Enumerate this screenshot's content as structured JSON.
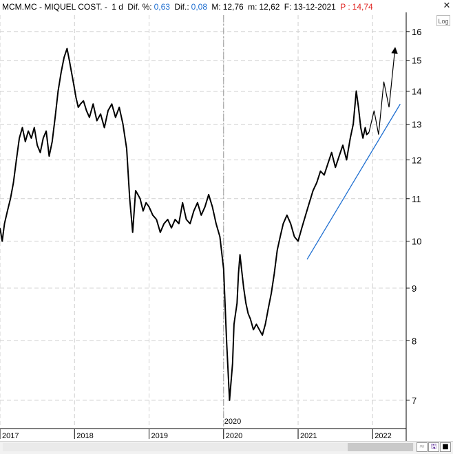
{
  "header": {
    "symbol": "MCM.MC - MIQUEL COST. -",
    "period": "1 d",
    "dif_pct_label": "Dif. %:",
    "dif_pct_value": "0,63",
    "dif_label": "Dif.:",
    "dif_value": "0,08",
    "max_label": "M:",
    "max_value": "12,76",
    "min_label": "m:",
    "min_value": "12,62",
    "date_label": "F:",
    "date_value": "13-12-2021",
    "price_label": "P :",
    "price_value": "14,74"
  },
  "controls": {
    "close_glyph": "✕",
    "log_label": "Log",
    "toggle_glyph": "≈",
    "save_glyph": "🖫",
    "pin_glyph": "⊣",
    "fill_glyph": "■"
  },
  "colors": {
    "price": "#000000",
    "trendline": "#1f6fd1",
    "grid": "#cfcfcf",
    "projection": "#000000"
  },
  "chart_data": {
    "type": "line",
    "title": "",
    "scale": "log",
    "grid": true,
    "ylim": [
      6.6,
      16.6
    ],
    "y_ticks": [
      7,
      8,
      9,
      10,
      11,
      12,
      13,
      14,
      15,
      16
    ],
    "x_range": [
      2017.0,
      2022.45
    ],
    "x_ticks": [
      "2017",
      "2018",
      "2019",
      "2020",
      "2021",
      "2022"
    ],
    "x_tick_values": [
      2017,
      2018,
      2019,
      2020,
      2021,
      2022
    ],
    "x_marker_label": "2020",
    "x_marker": 2020.0,
    "series": [
      {
        "x": [
          2017.0,
          2017.03,
          2017.06,
          2017.1,
          2017.14,
          2017.18,
          2017.22,
          2017.26,
          2017.3,
          2017.34,
          2017.38,
          2017.42,
          2017.46,
          2017.5,
          2017.54,
          2017.58,
          2017.62,
          2017.66,
          2017.7,
          2017.74,
          2017.78,
          2017.82,
          2017.86,
          2017.9,
          2017.93,
          2017.96,
          2017.99,
          2018.02,
          2018.05,
          2018.08,
          2018.12,
          2018.16,
          2018.2,
          2018.25,
          2018.3,
          2018.35,
          2018.4,
          2018.45,
          2018.5,
          2018.55,
          2018.6,
          2018.65,
          2018.7,
          2018.74,
          2018.78,
          2018.82,
          2018.85,
          2018.88,
          2018.92,
          2018.96,
          2019.0,
          2019.05,
          2019.1,
          2019.15,
          2019.2,
          2019.25,
          2019.3,
          2019.35,
          2019.4,
          2019.45,
          2019.5,
          2019.55,
          2019.6,
          2019.65,
          2019.7,
          2019.75,
          2019.8,
          2019.85,
          2019.9,
          2019.95,
          2020.0,
          2020.04,
          2020.08,
          2020.12,
          2020.14,
          2020.16,
          2020.18,
          2020.2,
          2020.22,
          2020.24,
          2020.27,
          2020.3,
          2020.33,
          2020.36,
          2020.4,
          2020.44,
          2020.48,
          2020.52,
          2020.56,
          2020.6,
          2020.64,
          2020.68,
          2020.72,
          2020.76,
          2020.8,
          2020.85,
          2020.9,
          2020.95,
          2021.0,
          2021.05,
          2021.1,
          2021.15,
          2021.2,
          2021.25,
          2021.3,
          2021.35,
          2021.4,
          2021.45,
          2021.5,
          2021.55,
          2021.6,
          2021.65,
          2021.7,
          2021.74,
          2021.78,
          2021.81,
          2021.84,
          2021.87,
          2021.9,
          2021.92,
          2021.95
        ],
        "values": [
          10.3,
          10.0,
          10.4,
          10.7,
          11.0,
          11.4,
          12.0,
          12.6,
          12.9,
          12.5,
          12.8,
          12.6,
          12.9,
          12.4,
          12.2,
          12.6,
          12.8,
          12.1,
          12.5,
          13.2,
          14.0,
          14.6,
          15.1,
          15.4,
          15.0,
          14.6,
          14.2,
          13.8,
          13.5,
          13.6,
          13.7,
          13.4,
          13.2,
          13.6,
          13.1,
          13.3,
          12.9,
          13.4,
          13.6,
          13.2,
          13.5,
          13.0,
          12.3,
          11.0,
          10.2,
          11.2,
          11.1,
          11.0,
          10.7,
          10.9,
          10.8,
          10.6,
          10.5,
          10.2,
          10.4,
          10.5,
          10.3,
          10.5,
          10.4,
          10.9,
          10.5,
          10.4,
          10.7,
          10.9,
          10.6,
          10.8,
          11.1,
          10.8,
          10.4,
          10.1,
          9.4,
          8.0,
          7.0,
          7.6,
          8.3,
          8.5,
          8.7,
          9.3,
          9.7,
          9.4,
          9.0,
          8.7,
          8.5,
          8.4,
          8.2,
          8.3,
          8.2,
          8.1,
          8.3,
          8.6,
          8.9,
          9.3,
          9.8,
          10.1,
          10.4,
          10.6,
          10.4,
          10.1,
          10.0,
          10.3,
          10.6,
          10.9,
          11.2,
          11.4,
          11.7,
          11.6,
          11.9,
          12.2,
          11.8,
          12.1,
          12.4,
          12.0,
          12.6,
          13.0,
          14.0,
          13.5,
          12.9,
          12.6,
          12.9,
          12.7,
          12.76
        ]
      }
    ],
    "projection": {
      "x": [
        2021.95,
        2022.02,
        2022.08,
        2022.15,
        2022.22,
        2022.3
      ],
      "values": [
        12.76,
        13.4,
        12.7,
        14.3,
        13.5,
        15.4
      ]
    },
    "trendline": {
      "x": [
        2021.12,
        2022.37
      ],
      "values": [
        9.6,
        13.6
      ]
    }
  }
}
